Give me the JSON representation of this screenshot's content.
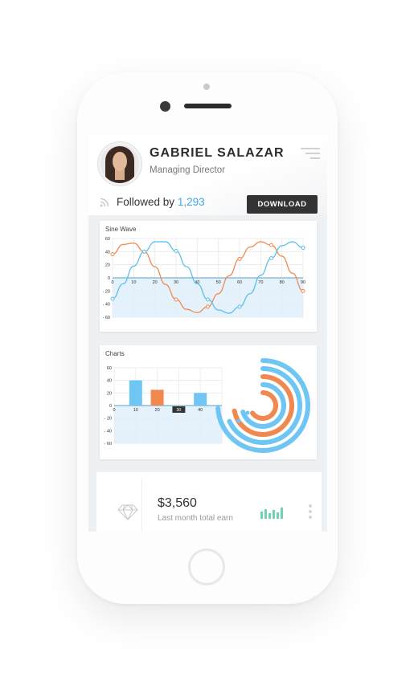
{
  "profile": {
    "name": "GABRIEL SALAZAR",
    "role": "Managing Director",
    "followed_label": "Followed by",
    "followers": "1,293",
    "download_label": "DOWNLOAD"
  },
  "icons": {
    "menu": "menu-icon",
    "rss": "rss-icon",
    "diamond": "diamond-icon",
    "more": "more-icon",
    "mini_bars": "mini-bar-chart-icon"
  },
  "colors": {
    "blue": "#5bc0ea",
    "orange": "#f08950",
    "dark": "#333333",
    "teal": "#6fd3b0"
  },
  "stats": {
    "amount": "$3,560",
    "label": "Last month total earn"
  },
  "chart_data": [
    {
      "type": "line",
      "title": "Sine Wave",
      "x": [
        0,
        5,
        10,
        15,
        20,
        25,
        30,
        35,
        40,
        45,
        50,
        55,
        60,
        65,
        70,
        75,
        80,
        85,
        90
      ],
      "xticks": [
        0,
        10,
        20,
        30,
        40,
        50,
        60,
        70,
        80,
        90
      ],
      "yticks": [
        60,
        40,
        20,
        0,
        -20,
        -40,
        -60
      ],
      "ylim": [
        -60,
        60
      ],
      "series": [
        {
          "color": "#f08950",
          "values": [
            36,
            51,
            53,
            40,
            17,
            -10,
            -33,
            -48,
            -53,
            -44,
            -24,
            3,
            29,
            47,
            55,
            50,
            33,
            7,
            -20
          ]
        },
        {
          "color": "#5bc0ea",
          "values": [
            -32,
            -9,
            18,
            40,
            55,
            55,
            41,
            17,
            -9,
            -33,
            -49,
            -54,
            -44,
            -24,
            4,
            30,
            49,
            55,
            46
          ]
        }
      ]
    },
    {
      "type": "bar",
      "title": "Charts",
      "categories": [
        10,
        20,
        30,
        40
      ],
      "values": [
        40,
        25,
        0,
        20
      ],
      "bar_colors": [
        "#6fc5f3",
        "#f08950",
        "#333333",
        "#6fc5f3"
      ],
      "highlight_label": "30",
      "yticks": [
        60,
        40,
        20,
        0,
        -20,
        -40,
        -60
      ],
      "ylim": [
        -60,
        60
      ]
    },
    {
      "type": "radial",
      "series": [
        {
          "color": "#6fc5f3",
          "fraction": 0.74
        },
        {
          "color": "#6fc5f3",
          "fraction": 0.68
        },
        {
          "color": "#f08950",
          "fraction": 0.72
        },
        {
          "color": "#6fc5f3",
          "fraction": 0.7
        },
        {
          "color": "#f08950",
          "fraction": 0.65
        }
      ]
    }
  ]
}
